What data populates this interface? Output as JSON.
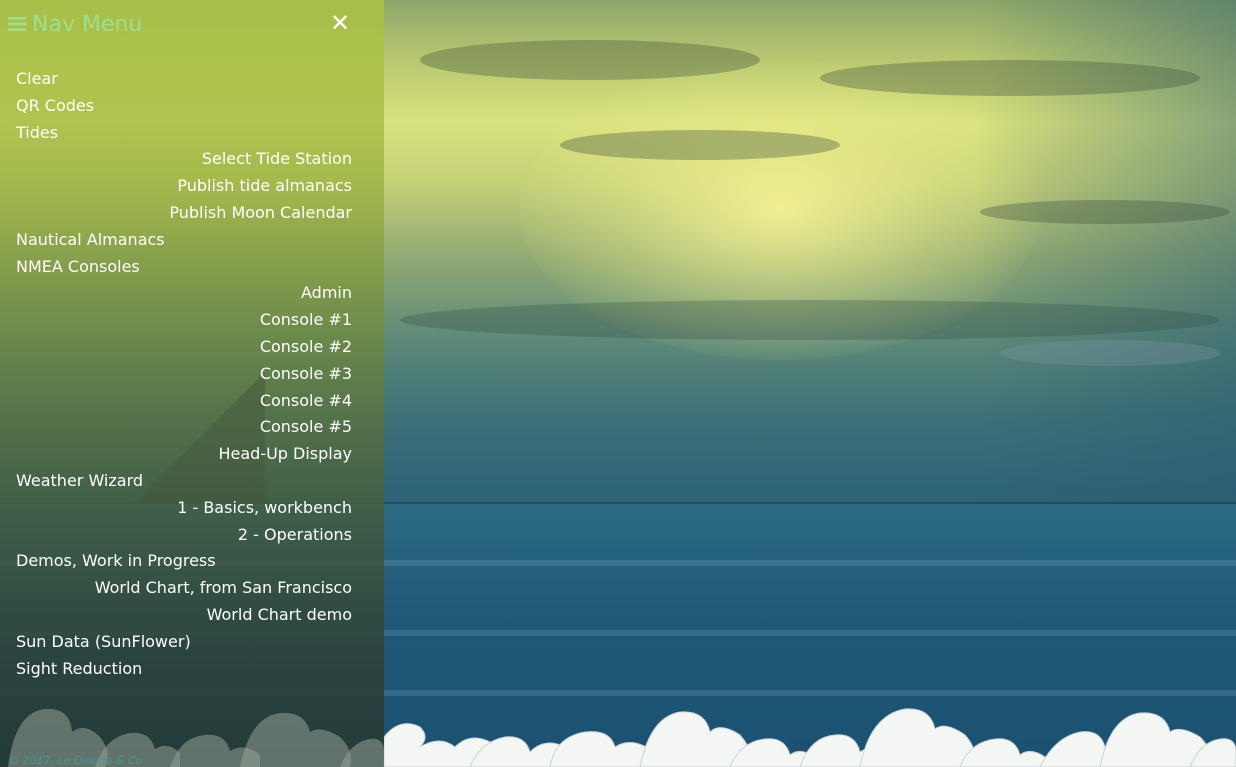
{
  "nav": {
    "title": "Nav Menu",
    "menu_icon": "hamburger-icon",
    "close_icon": "close-icon",
    "close_glyph": "✕",
    "items": [
      {
        "label": "Clear",
        "level": 0
      },
      {
        "label": "QR Codes",
        "level": 0
      },
      {
        "label": "Tides",
        "level": 0
      },
      {
        "label": "Select Tide Station",
        "level": 1
      },
      {
        "label": "Publish tide almanacs",
        "level": 1
      },
      {
        "label": "Publish Moon Calendar",
        "level": 1
      },
      {
        "label": "Nautical Almanacs",
        "level": 0
      },
      {
        "label": "NMEA Consoles",
        "level": 0
      },
      {
        "label": "Admin",
        "level": 1
      },
      {
        "label": "Console #1",
        "level": 1
      },
      {
        "label": "Console #2",
        "level": 1
      },
      {
        "label": "Console #3",
        "level": 1
      },
      {
        "label": "Console #4",
        "level": 1
      },
      {
        "label": "Console #5",
        "level": 1
      },
      {
        "label": "Head-Up Display",
        "level": 1
      },
      {
        "label": "Weather Wizard",
        "level": 0
      },
      {
        "label": "1 - Basics, workbench",
        "level": 1
      },
      {
        "label": "2 - Operations",
        "level": 1
      },
      {
        "label": "Demos, Work in Progress",
        "level": 0
      },
      {
        "label": "World Chart, from San Francisco",
        "level": 1
      },
      {
        "label": "World Chart demo",
        "level": 1
      },
      {
        "label": "Sun Data (SunFlower)",
        "level": 0
      },
      {
        "label": "Sight Reduction",
        "level": 0
      }
    ],
    "footer": "© 2017, Le Diouris & Co"
  },
  "colors": {
    "title": "#9fe08e",
    "menu_text": "#ffffff",
    "footer_text": "#3f9a96"
  }
}
